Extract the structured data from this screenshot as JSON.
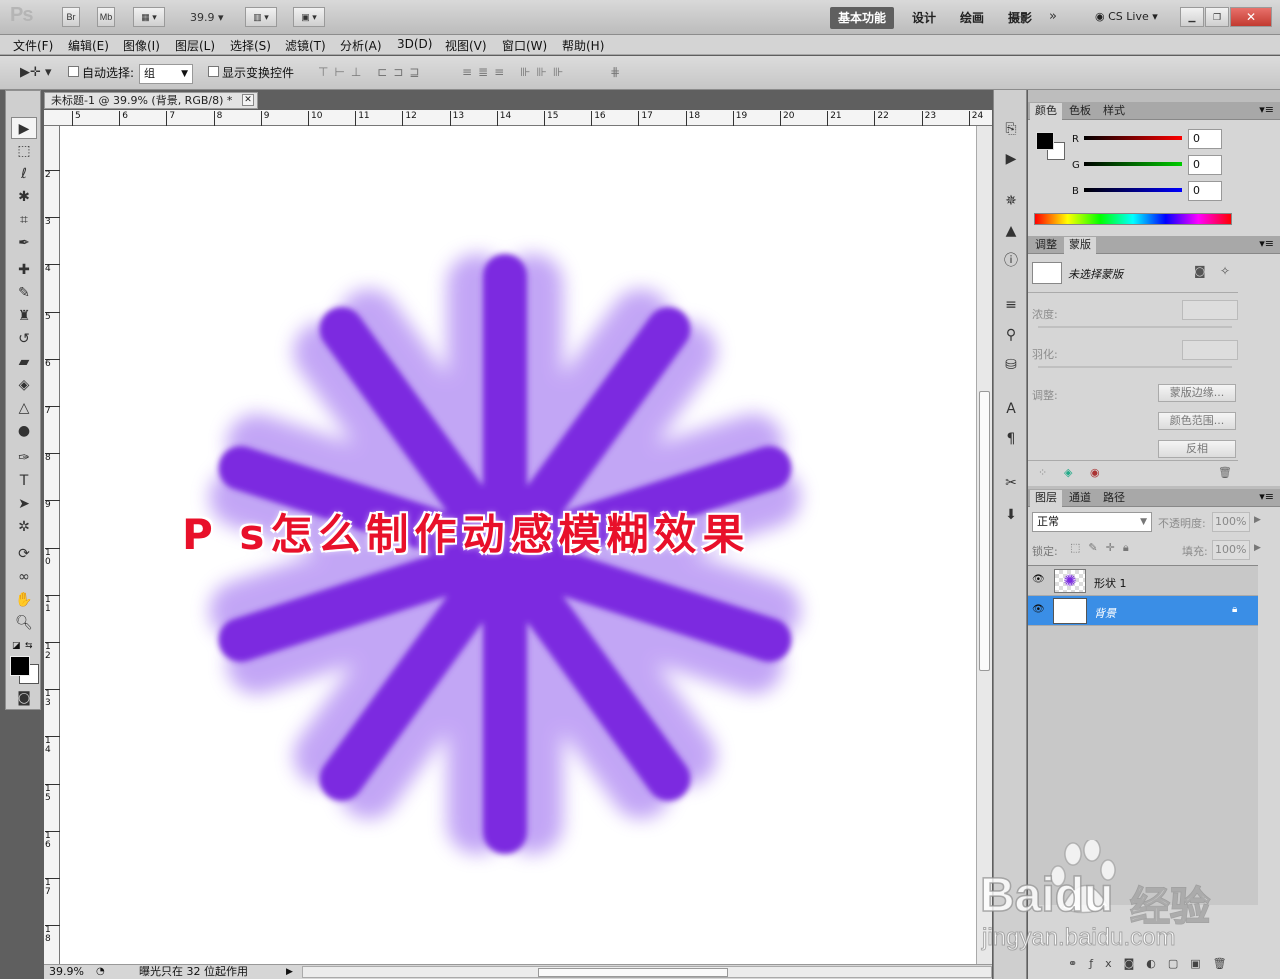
{
  "app": {
    "logo": "Ps",
    "bridge": "Br",
    "minibridge": "Mb",
    "zoom": "39.9",
    "cslive": "CS Live"
  },
  "workspaces": [
    "基本功能",
    "设计",
    "绘画",
    "摄影"
  ],
  "menu": [
    "文件(F)",
    "编辑(E)",
    "图像(I)",
    "图层(L)",
    "选择(S)",
    "滤镜(T)",
    "分析(A)",
    "3D(D)",
    "视图(V)",
    "窗口(W)",
    "帮助(H)"
  ],
  "options": {
    "auto_select_label": "自动选择:",
    "auto_select_value": "组",
    "show_transform_label": "显示变换控件"
  },
  "document": {
    "tab_title": "未标题-1 @ 39.9% (背景, RGB/8) *",
    "ruler_top": [
      "5",
      "6",
      "7",
      "8",
      "9",
      "10",
      "11",
      "12",
      "13",
      "14",
      "15",
      "16",
      "17",
      "18",
      "19",
      "20",
      "21",
      "22",
      "23",
      "24"
    ],
    "ruler_left": [
      "2",
      "3",
      "4",
      "5",
      "6",
      "7",
      "8",
      "9",
      "1 0",
      "1 1",
      "1 2",
      "1 3",
      "1 4",
      "1 5",
      "1 6",
      "1 7",
      "1 8"
    ],
    "headline": "P s怎么制作动感模糊效果",
    "shape_color": "#7b2be0",
    "headline_color": "#e8102a"
  },
  "status": {
    "zoom": "39.9%",
    "message": "曝光只在 32 位起作用"
  },
  "color_panel": {
    "tabs": [
      "颜色",
      "色板",
      "样式"
    ],
    "channels": [
      {
        "label": "R",
        "value": "0"
      },
      {
        "label": "G",
        "value": "0"
      },
      {
        "label": "B",
        "value": "0"
      }
    ]
  },
  "masks_panel": {
    "tabs": [
      "调整",
      "蒙版"
    ],
    "no_mask": "未选择蒙版",
    "density": "浓度:",
    "feather": "羽化:",
    "refine": "调整:",
    "buttons": [
      "蒙版边缘...",
      "颜色范围...",
      "反相"
    ]
  },
  "layers_panel": {
    "tabs": [
      "图层",
      "通道",
      "路径"
    ],
    "blend_mode": "正常",
    "opacity_label": "不透明度:",
    "opacity": "100%",
    "lock_label": "锁定:",
    "fill_label": "填充:",
    "fill": "100%",
    "layers": [
      {
        "name": "形状 1",
        "selected": false
      },
      {
        "name": "背景",
        "selected": true
      }
    ]
  },
  "watermark": {
    "brand": "Bai",
    "brand2": "du",
    "cn": "经验",
    "url": "jingyan.baidu.com"
  }
}
